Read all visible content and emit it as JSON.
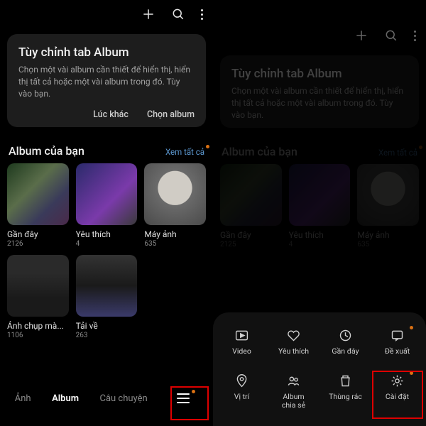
{
  "tip": {
    "title": "Tùy chỉnh tab Album",
    "text": "Chọn một vài album cần thiết để hiển thị, hiển thị tất cả hoặc một vài album trong đó. Tùy vào bạn.",
    "later": "Lúc khác",
    "choose": "Chọn album"
  },
  "section": {
    "title": "Album của bạn",
    "see_all": "Xem tất cả"
  },
  "albums": [
    {
      "name": "Gần đây",
      "count": "2126"
    },
    {
      "name": "Yêu thích",
      "count": "4"
    },
    {
      "name": "Máy ảnh",
      "count": "635"
    },
    {
      "name": "Ảnh chụp mà...",
      "count": "1106"
    },
    {
      "name": "Tải về",
      "count": "263"
    }
  ],
  "albums_right": [
    {
      "name": "Gần đây",
      "count": "2125"
    },
    {
      "name": "Yêu thích",
      "count": "4"
    },
    {
      "name": "Máy ảnh",
      "count": "635"
    }
  ],
  "tabs": {
    "photos": "Ảnh",
    "album": "Album",
    "stories": "Câu chuyện"
  },
  "sheet": {
    "video": "Video",
    "favorite": "Yêu thích",
    "recent": "Gần đây",
    "suggest": "Đề xuất",
    "location": "Vị trí",
    "shared": "Album\nchia sẻ",
    "trash": "Thùng rác",
    "settings": "Cài đặt"
  }
}
